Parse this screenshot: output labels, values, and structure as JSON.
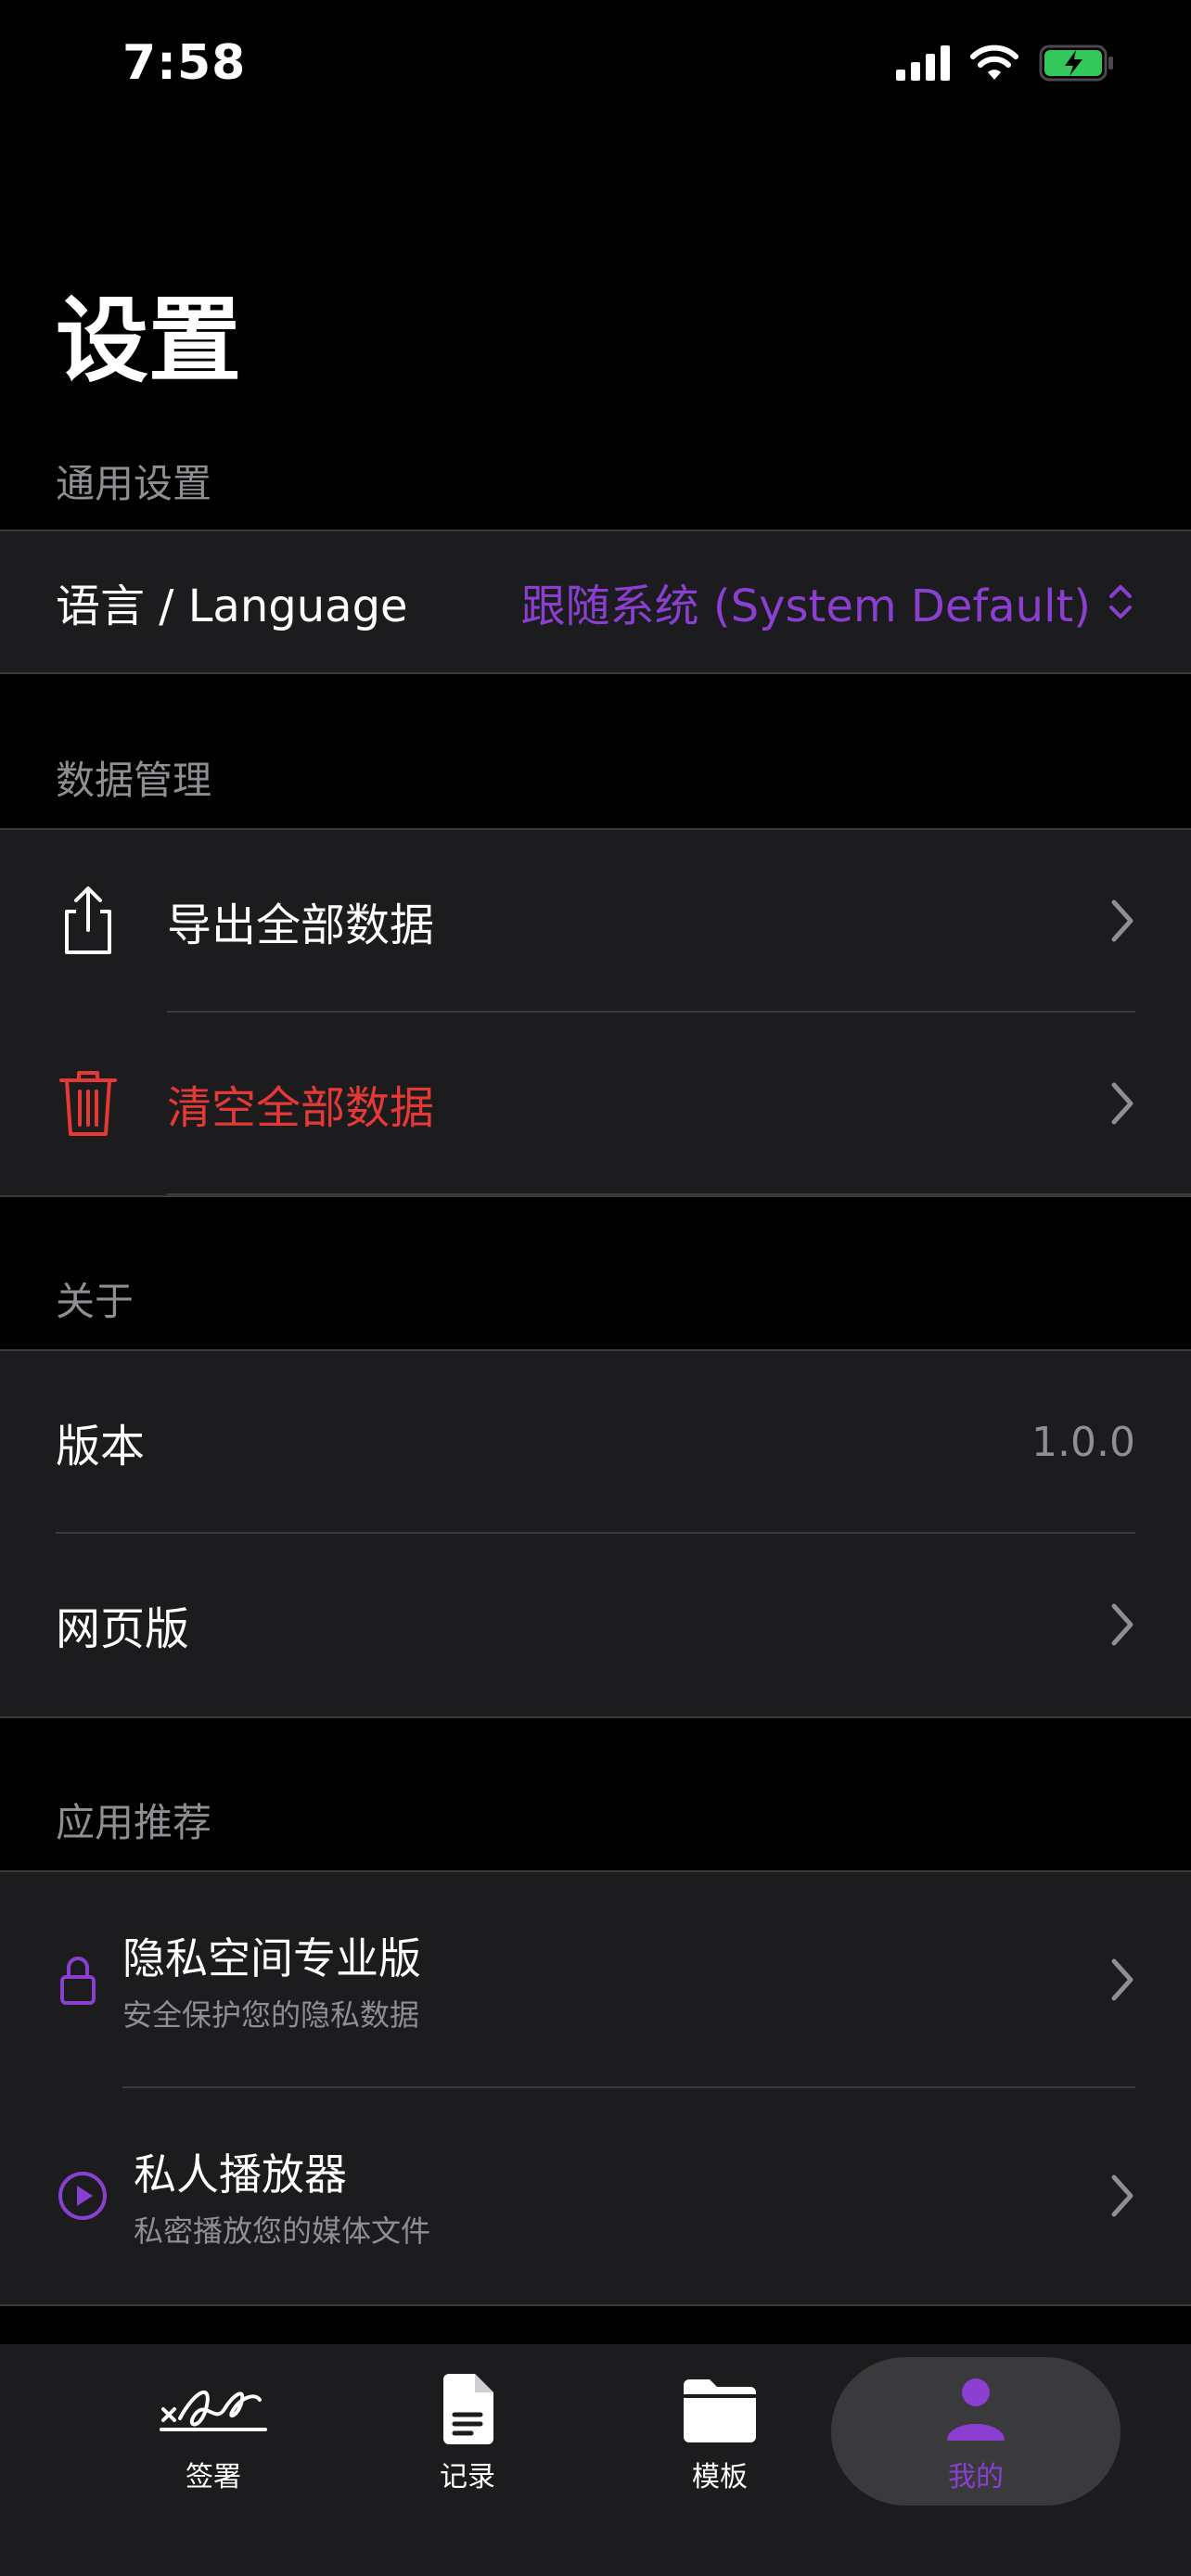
{
  "status": {
    "time": "7:58"
  },
  "title": "设置",
  "sections": {
    "general": {
      "header": "通用设置",
      "language_label": "语言 / Language",
      "language_value": "跟随系统 (System Default)"
    },
    "data": {
      "header": "数据管理",
      "export_label": "导出全部数据",
      "clear_label": "清空全部数据"
    },
    "about": {
      "header": "关于",
      "version_label": "版本",
      "version_value": "1.0.0",
      "web_label": "网页版"
    },
    "apps": {
      "header": "应用推荐",
      "items": [
        {
          "title": "隐私空间专业版",
          "subtitle": "安全保护您的隐私数据"
        },
        {
          "title": "私人播放器",
          "subtitle": "私密播放您的媒体文件"
        }
      ]
    }
  },
  "tabs": [
    {
      "label": "签署",
      "icon": "signature-icon"
    },
    {
      "label": "记录",
      "icon": "document-icon"
    },
    {
      "label": "模板",
      "icon": "folder-icon"
    },
    {
      "label": "我的",
      "icon": "person-icon"
    }
  ],
  "colors": {
    "accent": "#8a3fd1",
    "destructive": "#e53935",
    "background": "#000000",
    "group": "#1c1c1e",
    "separator": "#3a3a3c",
    "secondary_text": "#8e8e93"
  }
}
